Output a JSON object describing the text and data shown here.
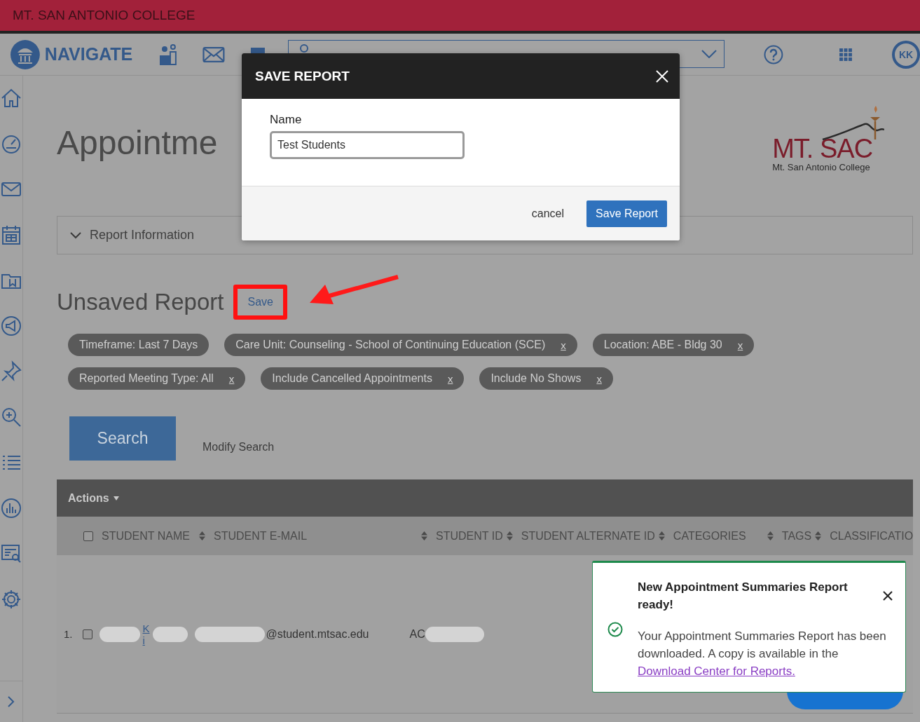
{
  "banner": {
    "title": "MT. SAN ANTONIO COLLEGE"
  },
  "nav": {
    "brand": "NAVIGATE",
    "avatar": "KK"
  },
  "page": {
    "title": "Appointme",
    "logo": {
      "wordmark": "MT. SAC",
      "subtitle": "Mt. San Antonio College"
    }
  },
  "report_info": {
    "label": "Report Information"
  },
  "report": {
    "title": "Unsaved Report",
    "save_label": "Save"
  },
  "filters": [
    {
      "label": "Timeframe: Last 7 Days"
    },
    {
      "label": "Care Unit: Counseling - School of Continuing Education (SCE)",
      "remove": "x"
    },
    {
      "label": "Location: ABE - Bldg 30",
      "remove": "x"
    },
    {
      "label": "Reported Meeting Type: All",
      "remove": "x"
    },
    {
      "label": "Include Cancelled Appointments",
      "remove": "x"
    },
    {
      "label": "Include No Shows",
      "remove": "x"
    }
  ],
  "search_button": "Search",
  "modify_link": "Modify Search",
  "table": {
    "actions": "Actions",
    "all_checked": false,
    "columns": [
      {
        "label": "STUDENT NAME",
        "sortable": true
      },
      {
        "label": "STUDENT E-MAIL",
        "sortable": true
      },
      {
        "label": "STUDENT ID",
        "sortable": true
      },
      {
        "label": "STUDENT ALTERNATE ID",
        "sortable": true
      },
      {
        "label": "CATEGORIES",
        "sortable": true
      },
      {
        "label": "TAGS",
        "sortable": true
      },
      {
        "label": "CLASSIFICATIO",
        "sortable": false
      }
    ],
    "rows": [
      {
        "number": "1.",
        "checked": false,
        "name_lines": [
          "K",
          "i"
        ],
        "email": "@student.mtsac.edu",
        "student_id": "AC"
      }
    ]
  },
  "modal": {
    "title": "SAVE REPORT",
    "field_label": "Name",
    "value": "Test Students",
    "cancel": "cancel",
    "submit": "Save Report"
  },
  "toast": {
    "title": "New Appointment Summaries Report ready!",
    "message": "Your Appointment Summaries Report has been downloaded. A copy is available in the",
    "link": "Download Center for Reports."
  }
}
